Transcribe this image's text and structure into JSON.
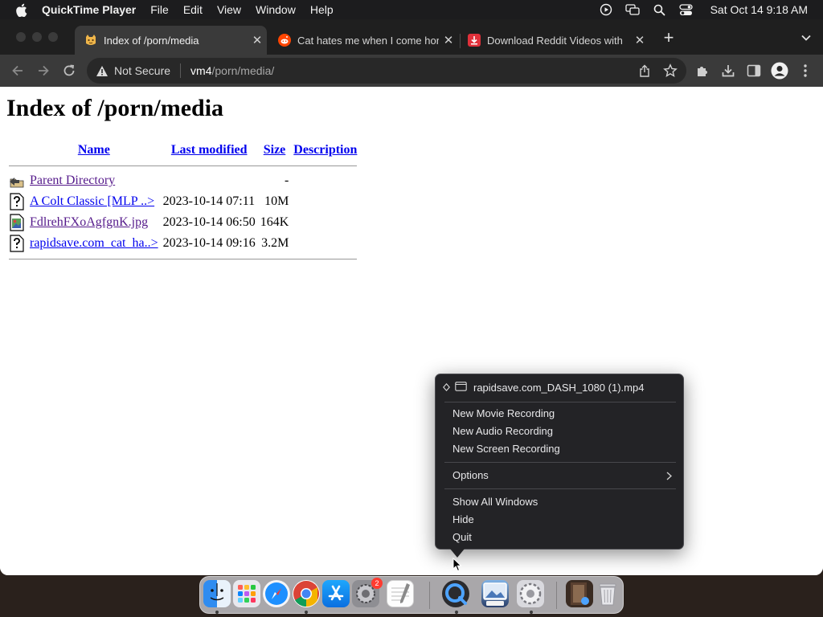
{
  "menubar": {
    "app_name": "QuickTime Player",
    "menus": [
      "File",
      "Edit",
      "View",
      "Window",
      "Help"
    ],
    "clock": "Sat Oct 14  9:18 AM"
  },
  "tabs": [
    {
      "title": "Index of /porn/media",
      "active": true,
      "favicon": "folder-cat-icon"
    },
    {
      "title": "Cat hates me when I come hor",
      "active": false,
      "favicon": "reddit-icon"
    },
    {
      "title": "Download Reddit Videos with",
      "active": false,
      "favicon": "rapidsave-icon"
    }
  ],
  "toolbar": {
    "security_label": "Not Secure",
    "url_host": "vm4",
    "url_path": "/porn/media/"
  },
  "page": {
    "heading": "Index of /porn/media",
    "columns": [
      "Name",
      "Last modified",
      "Size",
      "Description"
    ],
    "rows": [
      {
        "icon": "back-folder-icon",
        "name": "Parent Directory",
        "modified": "",
        "size": "-",
        "description": "",
        "visited": true
      },
      {
        "icon": "unknown-file-icon",
        "name": "A Colt Classic [MLP ..>",
        "modified": "2023-10-14 07:11",
        "size": "10M",
        "description": "",
        "visited": false
      },
      {
        "icon": "image-file-icon",
        "name": "FdlrehFXoAgfgnK.jpg",
        "modified": "2023-10-14 06:50",
        "size": "164K",
        "description": "",
        "visited": true
      },
      {
        "icon": "unknown-file-icon",
        "name": "rapidsave.com_cat_ha..>",
        "modified": "2023-10-14 09:16",
        "size": "3.2M",
        "description": "",
        "visited": false
      }
    ]
  },
  "dock_menu": {
    "window_item": "rapidsave.com_DASH_1080 (1).mp4",
    "items": [
      {
        "label": "New Movie Recording",
        "submenu": false
      },
      {
        "label": "New Audio Recording",
        "submenu": false
      },
      {
        "label": "New Screen Recording",
        "submenu": false
      },
      {
        "label": "Options",
        "submenu": true
      },
      {
        "label": "Show All Windows",
        "submenu": false
      },
      {
        "label": "Hide",
        "submenu": false
      },
      {
        "label": "Quit",
        "submenu": false
      }
    ]
  },
  "dock": {
    "apps": [
      "Finder",
      "Launchpad",
      "Safari",
      "Google Chrome",
      "App Store",
      "System Settings",
      "TextEdit",
      "QuickTime Player",
      "Preview",
      "System Preferences",
      "Downloads",
      "Trash"
    ],
    "settings_badge": "2"
  },
  "colors": {
    "link": "#0000ee",
    "visited_link": "#551a8b",
    "menu_bg": "#232326",
    "tab_active_bg": "#3a3a3a"
  }
}
